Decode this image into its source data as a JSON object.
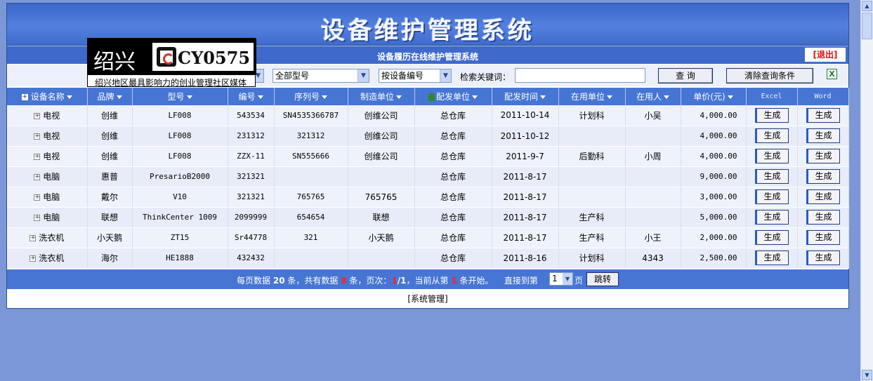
{
  "banner": {
    "title": "设备维护管理系统"
  },
  "subbar": {
    "subtitle": "设备履历在线维护管理系统",
    "logout": "[退出]"
  },
  "logo": {
    "city": "绍兴",
    "code": "CY0575",
    "slogan": "绍兴地区最具影响力的创业管理社区媒体"
  },
  "search": {
    "model_select": "全部型号",
    "order_select": "按设备编号",
    "keyword_label": "检索关键词：",
    "keyword_value": "",
    "query_button": "查 询",
    "clear_button": "清除查询条件"
  },
  "table": {
    "headers": [
      "设备名称",
      "品牌",
      "型号",
      "编号",
      "序列号",
      "制造单位",
      "配发单位",
      "配发时间",
      "在用单位",
      "在用人",
      "单价(元)",
      "Excel",
      "Word"
    ],
    "generate_label": "生成",
    "rows": [
      [
        "电视",
        "创维",
        "LF008",
        "543534",
        "SN4535366787",
        "创维公司",
        "总仓库",
        "2011-10-14",
        "计划科",
        "小吴",
        "4,000.00"
      ],
      [
        "电视",
        "创维",
        "LF008",
        "231312",
        "321312",
        "创维公司",
        "总仓库",
        "2011-10-12",
        "",
        "",
        "4,000.00"
      ],
      [
        "电视",
        "创维",
        "LF008",
        "ZZX-11",
        "SN555666",
        "创维公司",
        "总仓库",
        "2011-9-7",
        "后勤科",
        "小周",
        "4,000.00"
      ],
      [
        "电脑",
        "惠普",
        "PresarioB2000",
        "321321",
        "",
        "",
        "总仓库",
        "2011-8-17",
        "",
        "",
        "9,000.00"
      ],
      [
        "电脑",
        "戴尔",
        "V10",
        "321321",
        "765765",
        "765765",
        "总仓库",
        "2011-8-17",
        "",
        "",
        "3,000.00"
      ],
      [
        "电脑",
        "联想",
        "ThinkCenter 1009",
        "2099999",
        "654654",
        "联想",
        "总仓库",
        "2011-8-17",
        "生产科",
        "",
        "5,000.00"
      ],
      [
        "洗衣机",
        "小天鹅",
        "ZT15",
        "Sr44778",
        "321",
        "小天鹅",
        "总仓库",
        "2011-8-17",
        "生产科",
        "小王",
        "2,000.00"
      ],
      [
        "洗衣机",
        "海尔",
        "HE1888",
        "432432",
        "",
        "",
        "总仓库",
        "2011-8-16",
        "计划科",
        "4343",
        "2,500.00"
      ]
    ]
  },
  "pager": {
    "t1": "每页数据",
    "per_page": "20",
    "t2": "条，共有数据",
    "total": "8",
    "t3": "条，页次：",
    "current": "1",
    "slash_total": "/1",
    "t4": "，当前从第",
    "start": "1",
    "t5": "条开始。",
    "t6": "直接到第",
    "page_select": "1",
    "page_unit": "页",
    "jump_button": "跳转"
  },
  "footer": {
    "text": "[系统管理]"
  },
  "colors": {
    "accent": "#4675d3",
    "background": "#7b97d8",
    "logout_red": "#e31010"
  }
}
